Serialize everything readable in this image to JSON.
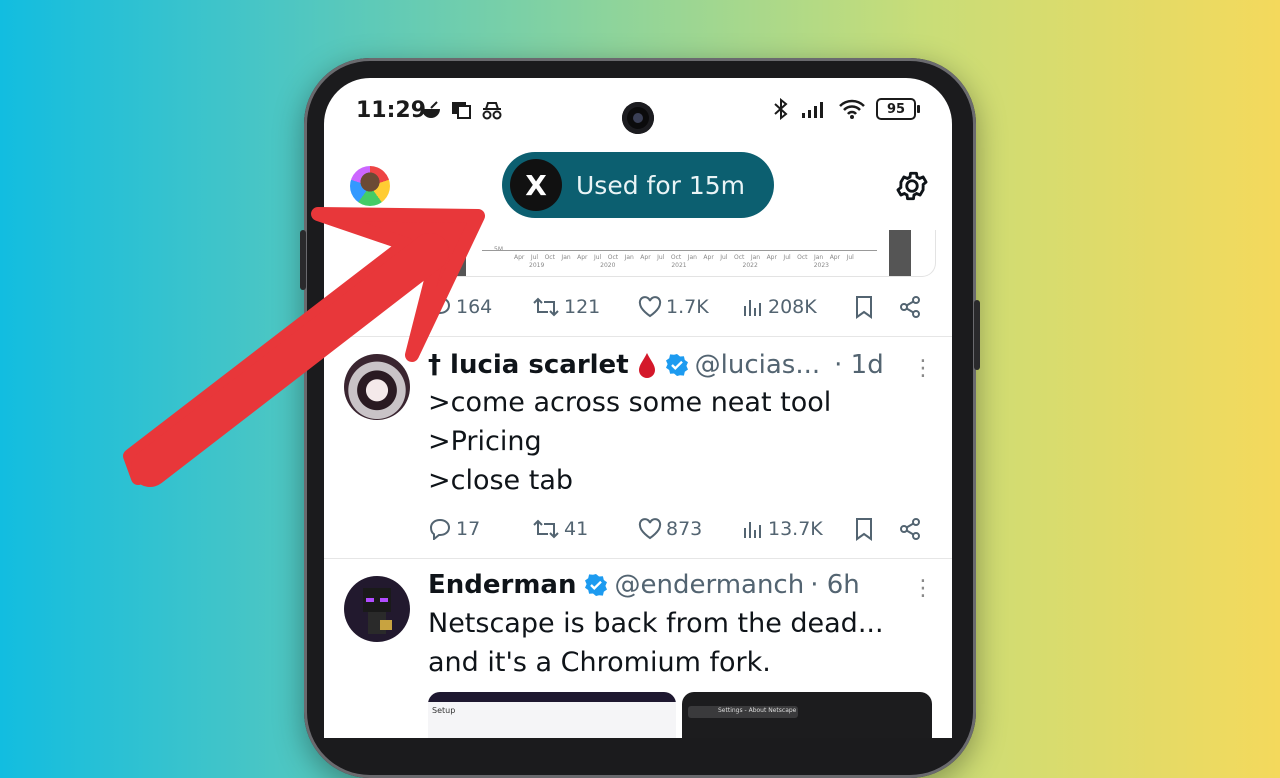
{
  "status_bar": {
    "time": "11:29",
    "battery": "95"
  },
  "header": {
    "pill_logo": "X",
    "pill_text": "Used for 15m"
  },
  "chart_remnant": {
    "ylabel": "5M",
    "ticks": [
      "Apr",
      "Jul",
      "Oct",
      "Jan",
      "Apr",
      "Jul",
      "Oct",
      "Jan",
      "Apr",
      "Jul",
      "Oct",
      "Jan",
      "Apr",
      "Jul",
      "Oct",
      "Jan",
      "Apr",
      "Jul",
      "Oct",
      "Jan",
      "Apr",
      "Jul"
    ],
    "years": [
      "2019",
      "2020",
      "2021",
      "2022",
      "2023"
    ]
  },
  "tweet0_actions": {
    "replies": "164",
    "retweets": "121",
    "likes": "1.7K",
    "views": "208K"
  },
  "tweets": [
    {
      "name": "† lucia scarlet",
      "handle": "@lucias...",
      "time": "· 1d",
      "lines": [
        ">come across some neat tool",
        ">Pricing",
        ">close tab"
      ],
      "replies": "17",
      "retweets": "41",
      "likes": "873",
      "views": "13.7K"
    },
    {
      "name": "Enderman",
      "handle": "@endermanch",
      "time": "· 6h",
      "lines": [
        "Netscape is back from the dead...",
        "and it's a Chromium fork."
      ],
      "media_left_label": "Setup",
      "media_right_label": "Settings - About Netscape"
    }
  ],
  "colors": {
    "pill_bg": "#0c5f70",
    "verified": "#1d9bf0",
    "arrow": "#e8373a"
  }
}
